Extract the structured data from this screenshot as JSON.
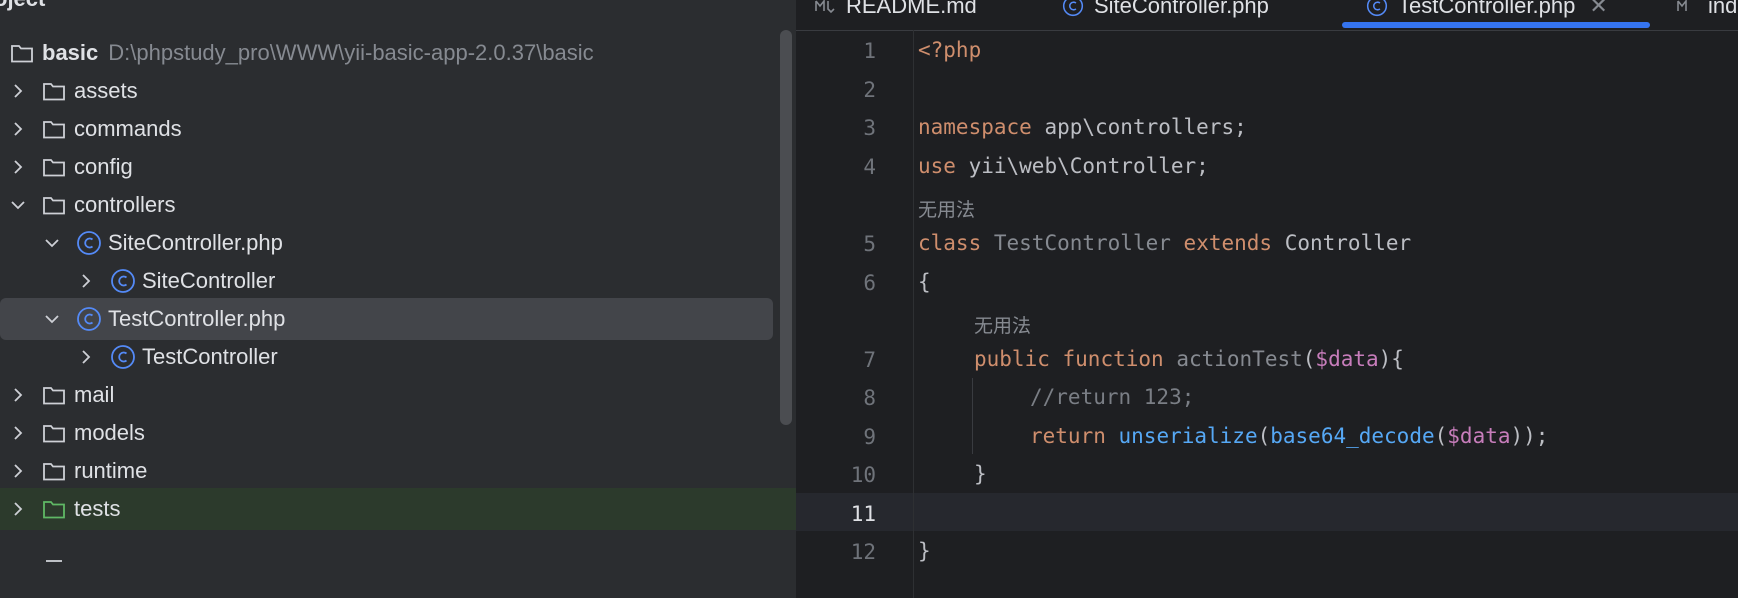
{
  "project_panel": {
    "title": "oject",
    "root": {
      "name": "basic",
      "path": "D:\\phpstudy_pro\\WWW\\yii-basic-app-2.0.37\\basic"
    },
    "items": [
      {
        "label": "assets"
      },
      {
        "label": "commands"
      },
      {
        "label": "config"
      },
      {
        "label": "controllers"
      },
      {
        "label": "SiteController.php"
      },
      {
        "label": "SiteController"
      },
      {
        "label": "TestController.php"
      },
      {
        "label": "TestController"
      },
      {
        "label": "mail"
      },
      {
        "label": "models"
      },
      {
        "label": "runtime"
      },
      {
        "label": "tests"
      }
    ],
    "icons": {
      "folder": "folder-icon",
      "class": "php-class-icon",
      "chevron": "chevron-icon"
    }
  },
  "tabs": [
    {
      "label": "README.md"
    },
    {
      "label": "SiteController.php"
    },
    {
      "label": "TestController.php",
      "active": true
    },
    {
      "label": "ind"
    }
  ],
  "editor": {
    "line_numbers": [
      "1",
      "2",
      "3",
      "4",
      "5",
      "6",
      "7",
      "8",
      "9",
      "10",
      "11",
      "12"
    ],
    "current_line": "11",
    "hints": {
      "class_usage": "无用法",
      "method_usage": "无用法"
    },
    "code": {
      "l1": "<?php",
      "l3_kw": "namespace",
      "l3_rest": " app\\controllers;",
      "l4_kw": "use",
      "l4_rest": " yii\\web\\Controller;",
      "l5_kw1": "class",
      "l5_cls": "TestController",
      "l5_kw2": "extends",
      "l5_parent": "Controller",
      "l6": "{",
      "l7_kw1": "public",
      "l7_kw2": "function",
      "l7_fn": "actionTest",
      "l7_open": "(",
      "l7_var": "$data",
      "l7_close": "){",
      "l8": "//return 123;",
      "l9_kw": "return",
      "l9_call1": "unserialize",
      "l9_p1": "(",
      "l9_call2": "base64_decode",
      "l9_p2": "(",
      "l9_var": "$data",
      "l9_end": "));",
      "l10": "}",
      "l12": "}"
    }
  },
  "colors": {
    "panel_bg": "#2b2d30",
    "editor_bg": "#1e1f22",
    "accent": "#3574f0",
    "keyword": "#cf8e6d",
    "variable": "#c77dbb",
    "call": "#56a8f5"
  }
}
